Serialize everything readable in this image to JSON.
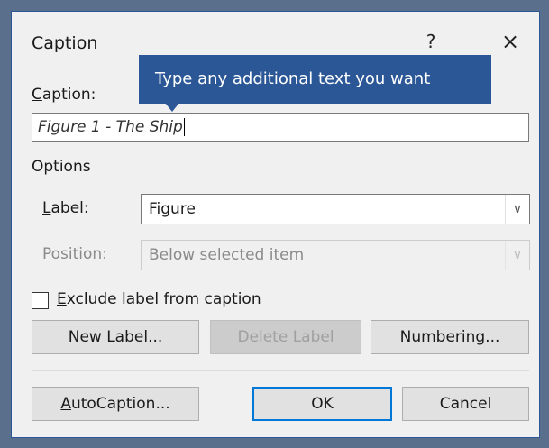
{
  "dialog": {
    "title": "Caption",
    "help": "?",
    "close": "×"
  },
  "tooltip": "Type any additional text you want",
  "caption": {
    "label_access_key": "C",
    "label_rest": "aption:",
    "value": "Figure 1 - The Ship"
  },
  "options": {
    "heading": "Options",
    "label_field": {
      "label_access_key": "L",
      "label_rest": "abel:",
      "value": "Figure"
    },
    "position_field": {
      "label": "Position:",
      "value": "Below selected item",
      "enabled": false
    }
  },
  "exclude": {
    "label_access_key": "E",
    "label_rest": "xclude label from caption",
    "checked": false
  },
  "buttons": {
    "new_label_key": "N",
    "new_label_rest": "ew Label...",
    "delete_label": "Delete Label",
    "numbering_pre": "N",
    "numbering_key": "u",
    "numbering_rest": "mbering...",
    "autocaption_key": "A",
    "autocaption_rest": "utoCaption...",
    "ok": "OK",
    "cancel": "Cancel"
  },
  "colors": {
    "accent": "#2b5797",
    "focus": "#0078d7"
  }
}
